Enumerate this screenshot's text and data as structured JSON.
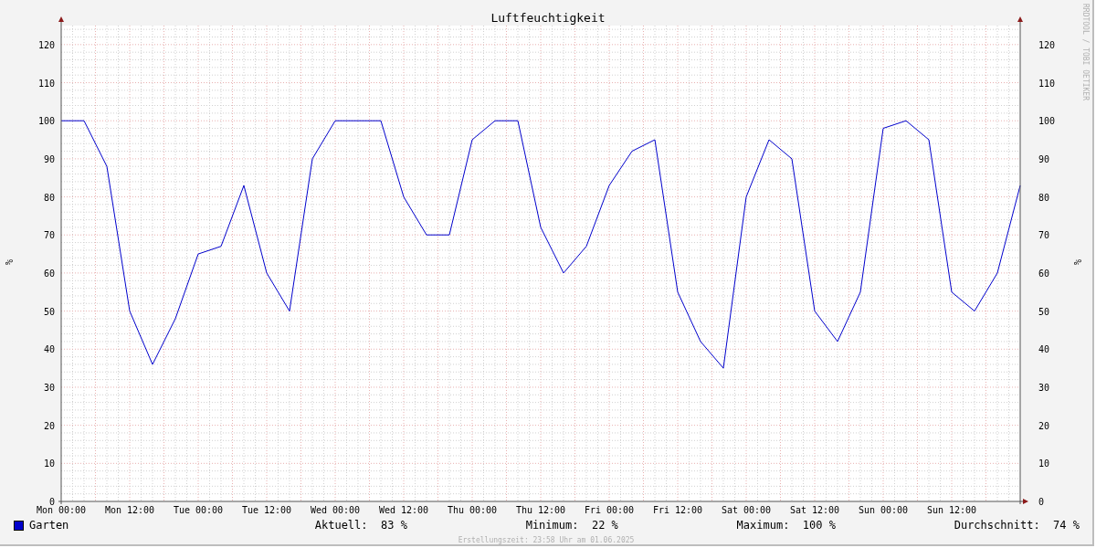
{
  "chart": {
    "chart_data": {
      "type": "line",
      "title": "Luftfeuchtigkeit",
      "ylabel": "%",
      "categories": [
        "Mon 00:00",
        null,
        null,
        "Mon 12:00",
        null,
        null,
        "Tue 00:00",
        null,
        null,
        "Tue 12:00",
        null,
        null,
        "Wed 00:00",
        null,
        null,
        "Wed 12:00",
        null,
        null,
        "Thu 00:00",
        null,
        null,
        "Thu 12:00",
        null,
        null,
        "Fri 00:00",
        null,
        null,
        "Fri 12:00",
        null,
        null,
        "Sat 00:00",
        null,
        null,
        "Sat 12:00",
        null,
        null,
        "Sun 00:00",
        null,
        null,
        "Sun 12:00",
        null,
        null,
        null
      ],
      "series": [
        {
          "name": "Garten",
          "color": "#0000cc",
          "values": [
            100,
            100,
            88,
            50,
            36,
            48,
            65,
            67,
            83,
            60,
            50,
            90,
            100,
            100,
            100,
            80,
            70,
            70,
            95,
            100,
            100,
            72,
            60,
            67,
            83,
            92,
            95,
            55,
            42,
            35,
            80,
            95,
            90,
            50,
            42,
            55,
            98,
            100,
            95,
            55,
            50,
            60,
            83
          ]
        }
      ],
      "ylim": [
        0,
        125
      ],
      "grid": true,
      "yticks": [
        0,
        10,
        20,
        30,
        40,
        50,
        60,
        70,
        80,
        90,
        100,
        110,
        120
      ]
    },
    "right_yticks": [
      "120",
      "110",
      "100",
      "90",
      "80",
      "70",
      "60",
      "50",
      "40",
      "30",
      "20",
      "10",
      "0"
    ],
    "ylabel_right": "%",
    "credit": "RRDTOOL / TOBI OETIKER"
  },
  "legend": {
    "stats": [
      {
        "label": "Aktuell:",
        "value": "83 %"
      },
      {
        "label": "Minimum:",
        "value": "22 %"
      },
      {
        "label": "Maximum:",
        "value": "100 %"
      },
      {
        "label": "Durchschnitt:",
        "value": "74 %"
      }
    ]
  },
  "footer": "Erstellungszeit: 23:58 Uhr am 01.06.2025"
}
